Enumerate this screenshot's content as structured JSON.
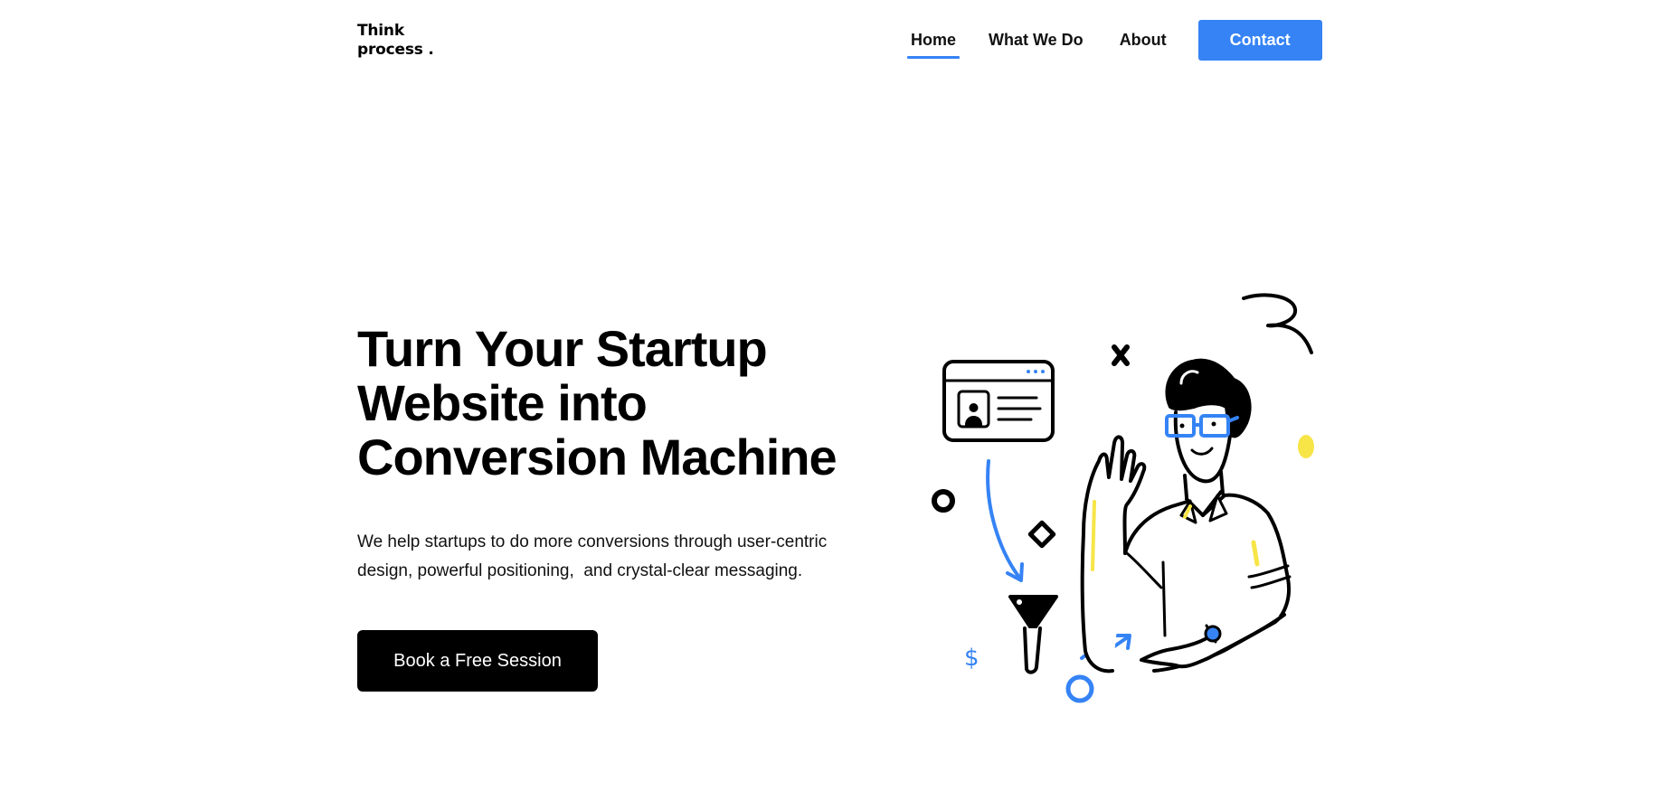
{
  "header": {
    "logo_line1": "Think",
    "logo_line2": "process .",
    "nav": {
      "home": "Home",
      "what_we_do": "What We Do",
      "about": "About",
      "contact": "Contact"
    }
  },
  "hero": {
    "title_line1": "Turn Your Startup",
    "title_line2": "Website into",
    "title_line3": "Conversion Machine",
    "subtitle_line1": "We help startups to do more conversions through user-centric",
    "subtitle_line2": "design, powerful positioning,  and crystal-clear messaging.",
    "cta_label": "Book a Free Session"
  },
  "illustration": {
    "dollar_symbol": "$",
    "colors": {
      "accent_blue": "#3583f5",
      "accent_yellow": "#f7e547",
      "ink": "#000000"
    }
  }
}
